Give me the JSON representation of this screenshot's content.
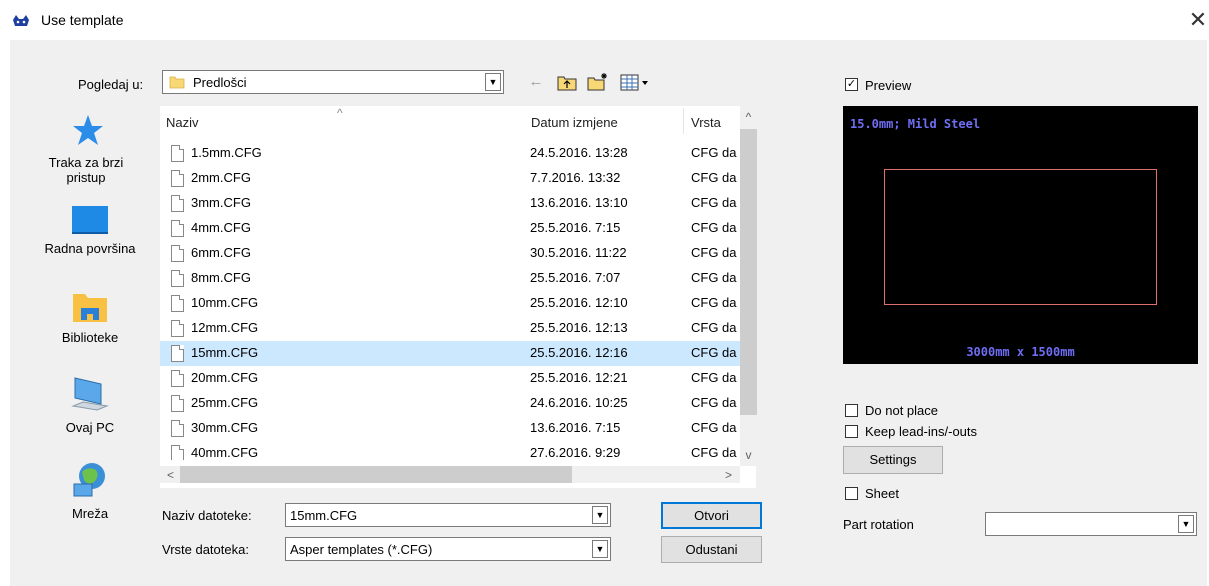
{
  "window": {
    "title": "Use template",
    "close_glyph": "✕"
  },
  "lookin": {
    "label": "Pogledaj u:",
    "value": "Predlošci"
  },
  "toolbar": {
    "back_glyph": "←",
    "up_glyph": "⬑",
    "newfolder_glyph": "✱",
    "view_glyph": "▦▾"
  },
  "places": [
    {
      "label_line1": "Traka za brzi",
      "label_line2": "pristup"
    },
    {
      "label_line1": "Radna površina",
      "label_line2": ""
    },
    {
      "label_line1": "Biblioteke",
      "label_line2": ""
    },
    {
      "label_line1": "Ovaj PC",
      "label_line2": ""
    },
    {
      "label_line1": "Mreža",
      "label_line2": ""
    }
  ],
  "columns": {
    "name": "Naziv",
    "date": "Datum izmjene",
    "type": "Vrsta",
    "sort_glyph": "^"
  },
  "files": [
    {
      "name": "1.5mm.CFG",
      "date": "24.5.2016. 13:28",
      "type": "CFG da"
    },
    {
      "name": "2mm.CFG",
      "date": "7.7.2016. 13:32",
      "type": "CFG da"
    },
    {
      "name": "3mm.CFG",
      "date": "13.6.2016. 13:10",
      "type": "CFG da"
    },
    {
      "name": "4mm.CFG",
      "date": "25.5.2016. 7:15",
      "type": "CFG da"
    },
    {
      "name": "6mm.CFG",
      "date": "30.5.2016. 11:22",
      "type": "CFG da"
    },
    {
      "name": "8mm.CFG",
      "date": "25.5.2016. 7:07",
      "type": "CFG da"
    },
    {
      "name": "10mm.CFG",
      "date": "25.5.2016. 12:10",
      "type": "CFG da"
    },
    {
      "name": "12mm.CFG",
      "date": "25.5.2016. 12:13",
      "type": "CFG da"
    },
    {
      "name": "15mm.CFG",
      "date": "25.5.2016. 12:16",
      "type": "CFG da",
      "selected": true
    },
    {
      "name": "20mm.CFG",
      "date": "25.5.2016. 12:21",
      "type": "CFG da"
    },
    {
      "name": "25mm.CFG",
      "date": "24.6.2016. 10:25",
      "type": "CFG da"
    },
    {
      "name": "30mm.CFG",
      "date": "13.6.2016. 7:15",
      "type": "CFG da"
    },
    {
      "name": "40mm.CFG",
      "date": "27.6.2016. 9:29",
      "type": "CFG da"
    }
  ],
  "filename": {
    "label": "Naziv datoteke:",
    "value": "15mm.CFG"
  },
  "filetype": {
    "label": "Vrste datoteka:",
    "value": "Asper templates (*.CFG)"
  },
  "buttons": {
    "open": "Otvori",
    "cancel": "Odustani",
    "settings": "Settings"
  },
  "preview": {
    "checkbox_label": "Preview",
    "checked": true,
    "title": "15.0mm; Mild Steel",
    "size": "3000mm x 1500mm",
    "bg_color": "#000000",
    "text_color": "#6e6ef5",
    "rect_color": "#e07070"
  },
  "options": {
    "do_not_place": "Do not place",
    "keep_leadins": "Keep lead-ins/-outs",
    "sheet": "Sheet",
    "part_rotation": "Part rotation",
    "part_rotation_value": ""
  },
  "scroll": {
    "up": "^",
    "down": "v",
    "left": "<",
    "right": ">",
    "dropdown": "▼"
  }
}
